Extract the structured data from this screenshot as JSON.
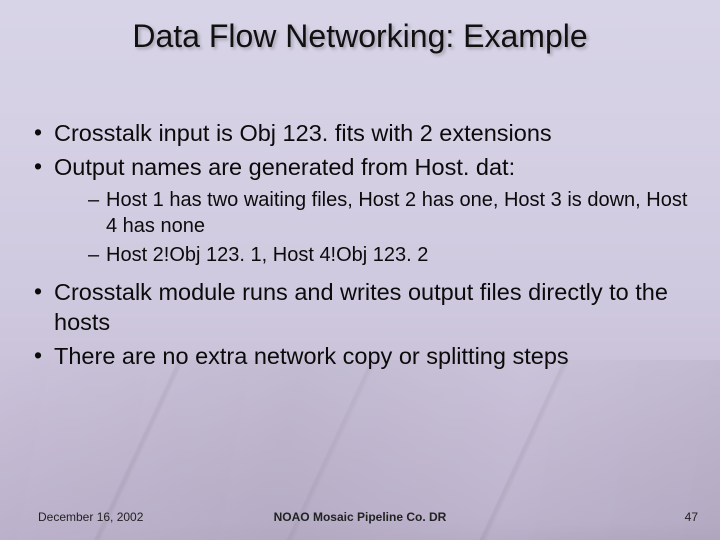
{
  "title": "Data Flow Networking: Example",
  "bullets": {
    "b1": "Crosstalk input is Obj 123. fits with 2 extensions",
    "b2": "Output names are generated from Host. dat:",
    "b2_sub1": "Host 1 has two waiting files, Host 2 has one, Host 3 is down, Host 4 has none",
    "b2_sub2": "Host 2!Obj 123. 1, Host 4!Obj 123. 2",
    "b3": "Crosstalk module runs and writes output files directly to the hosts",
    "b4": "There are no extra network copy or splitting steps"
  },
  "footer": {
    "date": "December 16, 2002",
    "center": "NOAO Mosaic  Pipeline Co. DR",
    "page": "47"
  }
}
